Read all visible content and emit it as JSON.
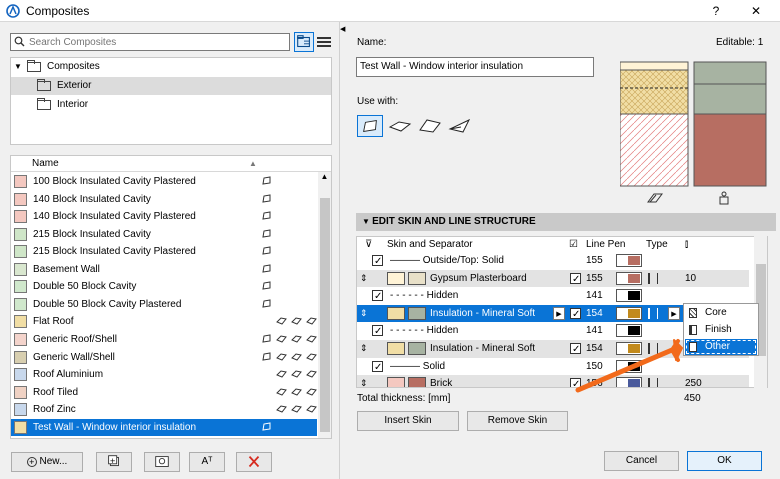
{
  "window": {
    "title": "Composites",
    "help": "?",
    "close": "✕"
  },
  "search": {
    "placeholder": "Search Composites",
    "value": ""
  },
  "tree": {
    "root": "Composites",
    "items": [
      "Exterior",
      "Interior"
    ]
  },
  "list": {
    "header": "Name",
    "items": [
      "100 Block Insulated Cavity Plastered",
      "140 Block Insulated Cavity",
      "140 Block Insulated Cavity Plastered",
      "215 Block Insulated Cavity",
      "215 Block Insulated Cavity Plastered",
      "Basement Wall",
      "Double 50 Block Cavity",
      "Double 50 Block Cavity Plastered",
      "Flat Roof",
      "Generic Roof/Shell",
      "Generic Wall/Shell",
      "Roof Aluminium",
      "Roof Tiled",
      "Roof Zinc",
      "Test Wall - Window interior insulation"
    ]
  },
  "bottom_buttons": {
    "new": "New...",
    "rename": "Aᵀ"
  },
  "name_label": "Name:",
  "name_value": "Test Wall - Window interior insulation",
  "editable": "Editable: 1",
  "use_with": "Use with:",
  "section_title": "EDIT SKIN AND LINE STRUCTURE",
  "grid": {
    "headers": {
      "skin": "Skin and Separator",
      "pen": "Line Pen",
      "type": "Type"
    },
    "rows": [
      {
        "kind": "sep",
        "label": "——— Outside/Top: Solid",
        "pen": "155"
      },
      {
        "kind": "skin",
        "label": "Gypsum Plasterboard",
        "pen": "155",
        "thickness": "10"
      },
      {
        "kind": "sep",
        "label": "- - - - - - Hidden",
        "pen": "141"
      },
      {
        "kind": "skin",
        "label": "Insulation - Mineral Soft",
        "pen": "154"
      },
      {
        "kind": "sep",
        "label": "- - - - - - Hidden",
        "pen": "141"
      },
      {
        "kind": "skin",
        "label": "Insulation - Mineral Soft",
        "pen": "154"
      },
      {
        "kind": "sep",
        "label": "——— Solid",
        "pen": "150"
      },
      {
        "kind": "skin",
        "label": "Brick",
        "pen": "156",
        "thickness": "250"
      }
    ]
  },
  "type_menu": [
    "Core",
    "Finish",
    "Other"
  ],
  "total_label": "Total thickness: [mm]",
  "total_value": "450",
  "insert_skin": "Insert Skin",
  "remove_skin": "Remove Skin",
  "cancel": "Cancel",
  "ok": "OK",
  "colors": {
    "accent": "#0a74d6",
    "arrow": "#f26a1b",
    "brick": "#b76e62",
    "insulation": "#f1dea5",
    "plaster": "#fff3d6"
  }
}
